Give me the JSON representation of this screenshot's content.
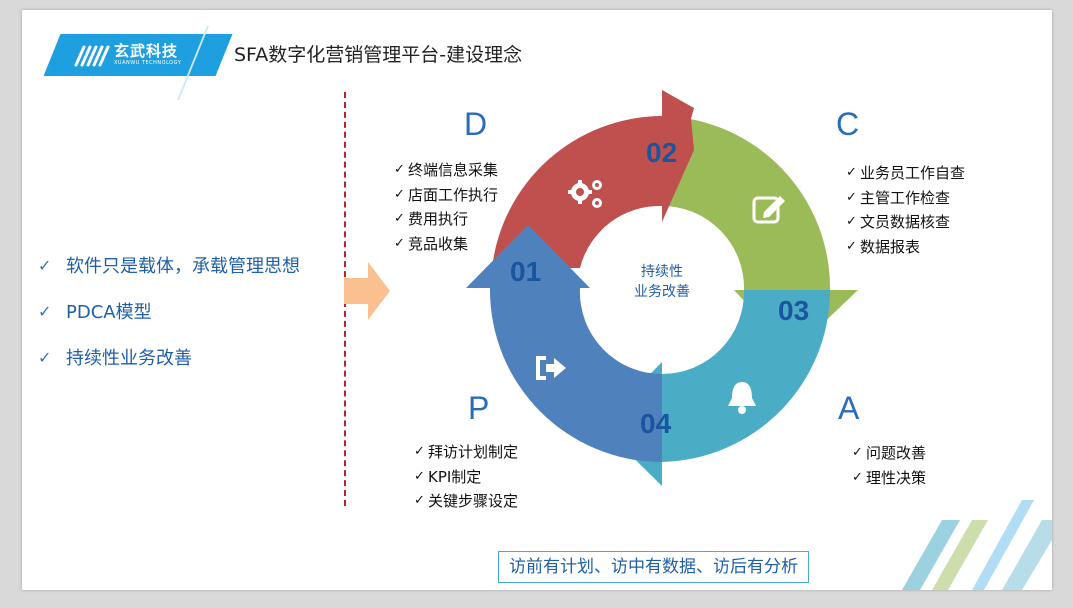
{
  "brand": {
    "name_cn": "玄武科技",
    "name_en": "XUANWU TECHNOLOGY",
    "color": "#1e9fe0"
  },
  "title": "SFA数字化营销管理平台-建设理念",
  "bullets": [
    "软件只是载体，承载管理思想",
    "PDCA模型",
    "持续性业务改善"
  ],
  "cycle": {
    "center": [
      "持续性",
      "业务改善"
    ],
    "letters": {
      "d": "D",
      "c": "C",
      "a": "A",
      "p": "P"
    },
    "numbers": {
      "n01": "01",
      "n02": "02",
      "n03": "03",
      "n04": "04"
    },
    "icons": {
      "d": "gears-icon",
      "c": "edit-icon",
      "a": "bell-icon",
      "p": "sign-in-icon"
    },
    "colors": {
      "red": "#c0504d",
      "green": "#9bbb59",
      "teal": "#4bacc6",
      "blue": "#4f81bd",
      "orange_arrow": "#fac090",
      "divider": "#b8232b"
    }
  },
  "lists": {
    "d": [
      "终端信息采集",
      "店面工作执行",
      "费用执行",
      "竞品收集"
    ],
    "c": [
      "业务员工作自查",
      "主管工作检查",
      "文员数据核查",
      "数据报表"
    ],
    "a": [
      "问题改善",
      "理性决策"
    ],
    "p": [
      "拜访计划制定",
      "KPI制定",
      "关键步骤设定"
    ]
  },
  "check_glyph": "✓",
  "tagline": "访前有计划、访中有数据、访后有分析"
}
